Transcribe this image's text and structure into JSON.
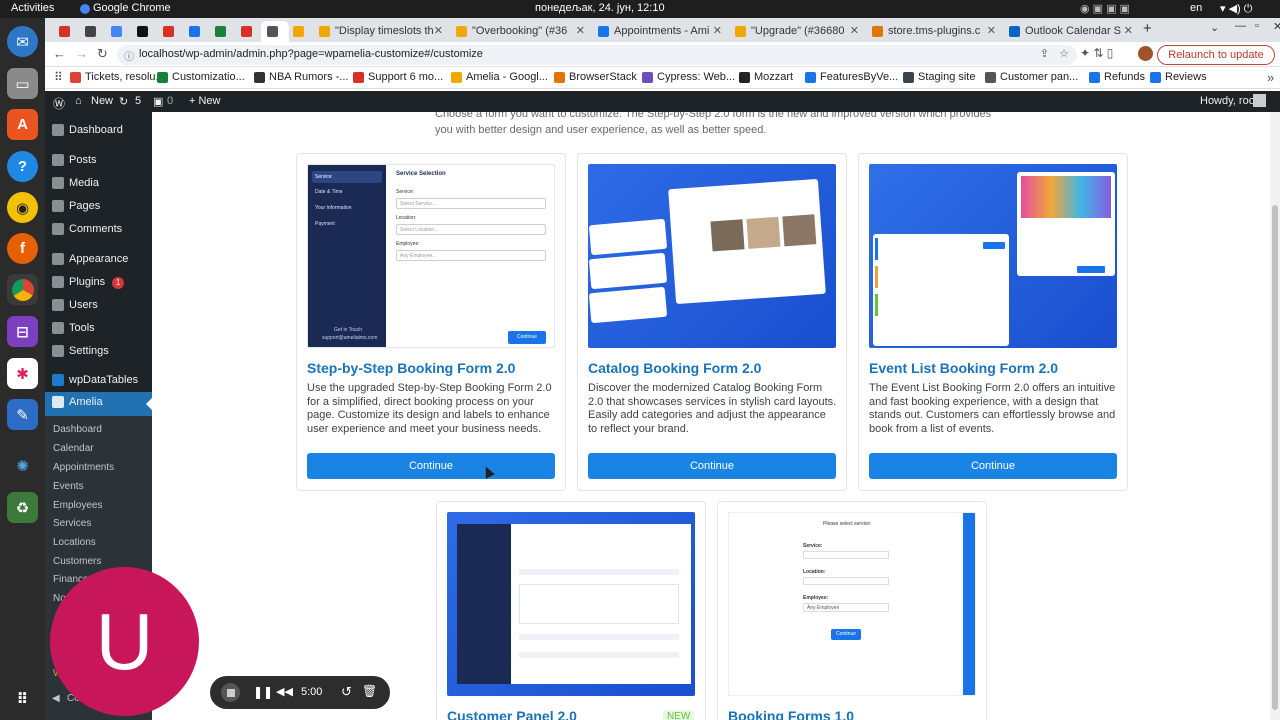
{
  "os": {
    "activities": "Activities",
    "app": "Google Chrome",
    "clock": "понедељак, 24. јун, 12:10",
    "lang": "en"
  },
  "tabs": [
    {
      "label": "",
      "color": "#d93025"
    },
    {
      "label": "",
      "color": "#444"
    },
    {
      "label": "",
      "color": "#4285f4"
    },
    {
      "label": "",
      "color": "#111"
    },
    {
      "label": "",
      "color": "#d93025"
    },
    {
      "label": "",
      "color": "#1a73e8"
    },
    {
      "label": "",
      "color": "#188038"
    },
    {
      "label": "",
      "color": "#d93025"
    },
    {
      "label": "",
      "color": "#555"
    },
    {
      "label": "",
      "color": "#f2a600"
    },
    {
      "label": "\"Display timeslots th",
      "color": "#f2a600"
    },
    {
      "label": "\"Overbooking\" (#36",
      "color": "#f2a600"
    },
    {
      "label": "Appointments - Ami",
      "color": "#1a73e8"
    },
    {
      "label": "\"Upgrade\" (#36680",
      "color": "#f2a600"
    },
    {
      "label": "store.tms-plugins.c",
      "color": "#e37400"
    },
    {
      "label": "Outlook Calendar S",
      "color": "#0a64c2"
    }
  ],
  "address": {
    "url": "localhost/wp-admin/admin.php?page=wpamelia-customize#/customize",
    "relaunch": "Relaunch to update"
  },
  "bookmarks": [
    {
      "label": "Tickets, resolu...",
      "color": "#db4437"
    },
    {
      "label": "Customizatio...",
      "color": "#188038"
    },
    {
      "label": "NBA Rumors -...",
      "color": "#333"
    },
    {
      "label": "Support 6 mo...",
      "color": "#d93025"
    },
    {
      "label": "Amelia - Googl...",
      "color": "#f2a600"
    },
    {
      "label": "BrowserStack",
      "color": "#e37400"
    },
    {
      "label": "Cypress: Web...",
      "color": "#6b4fbb"
    },
    {
      "label": "Mozzart",
      "color": "#222"
    },
    {
      "label": "FeaturesByVe...",
      "color": "#1a73e8"
    },
    {
      "label": "Staging site",
      "color": "#3c434a"
    },
    {
      "label": "Customer pan...",
      "color": "#555"
    },
    {
      "label": "Refunds",
      "color": "#1a73e8"
    },
    {
      "label": "Reviews",
      "color": "#1a73e8"
    }
  ],
  "wpbar": {
    "home": "New",
    "updates": "5",
    "comments": "0",
    "new": "+ New",
    "howdy": "Howdy, root"
  },
  "sidebar": {
    "items": [
      "Dashboard",
      "Posts",
      "Media",
      "Pages",
      "Comments",
      "Appearance",
      "Plugins",
      "Users",
      "Tools",
      "Settings",
      "wpDataTables",
      "Amelia"
    ],
    "plugins_badge": "1",
    "sub": [
      "Dashboard",
      "Calendar",
      "Appointments",
      "Events",
      "Employees",
      "Services",
      "Locations",
      "Customers",
      "Finance",
      "No",
      "W",
      "Co"
    ]
  },
  "intro": "Choose a form you want to customize. The Step-by-Step 2.0 form is the new and improved version which provides you with better design and user experience, as well as better speed.",
  "cards": [
    {
      "title": "Step-by-Step Booking Form 2.0",
      "desc": "Use the upgraded Step-by-Step Booking Form 2.0 for a simplified, direct booking process on your page. Customize its design and labels to enhance user experience and meet your business needs.",
      "button": "Continue"
    },
    {
      "title": "Catalog Booking Form 2.0",
      "desc": "Discover the modernized Catalog Booking Form 2.0 that showcases services in stylish card layouts. Easily add categories and adjust the appearance to reflect your brand.",
      "button": "Continue"
    },
    {
      "title": "Event List Booking Form 2.0",
      "desc": "The Event List Booking Form 2.0 offers an intuitive and fast booking experience, with a design that stands out. Customers can effortlessly browse and book from a list of events.",
      "button": "Continue"
    },
    {
      "title": "Customer Panel 2.0",
      "badge": "NEW"
    },
    {
      "title": "Booking Forms 1.0"
    }
  ],
  "preview1": {
    "title": "Service Selection",
    "steps": [
      "Service",
      "Date & Time",
      "Your Information",
      "Payment"
    ],
    "labels": [
      "Service:",
      "Location:",
      "Employee:"
    ],
    "placeholders": [
      "Select Service...",
      "Select Location...",
      "Any Employee..."
    ],
    "footer": "Get in Touch",
    "email": "support@ameliatms.com",
    "btn": "Continue"
  },
  "preview5": {
    "title": "Please select service:",
    "labels": [
      "Service:",
      "Location:",
      "Employee:"
    ],
    "emp": "Any Employee",
    "btn": "Continue"
  },
  "avatar": "U",
  "recorder": {
    "time": "5:00"
  }
}
